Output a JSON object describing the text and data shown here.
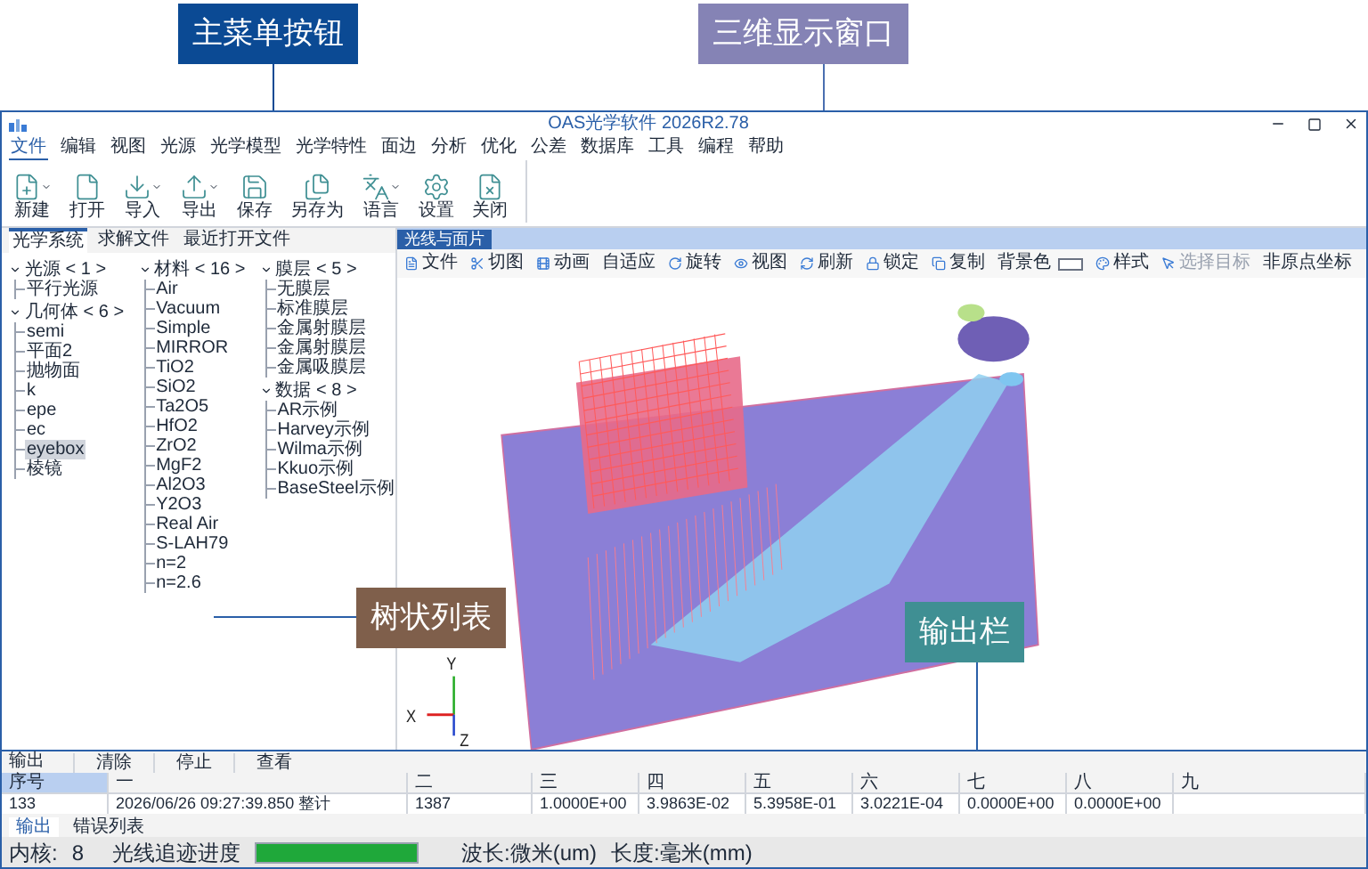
{
  "callouts": [
    {
      "text": "主菜单按钮",
      "color": "#0b4a94"
    },
    {
      "text": "三维显示窗口",
      "color": "#8583b5"
    },
    {
      "text": "树状列表",
      "color": "#7f5f4b"
    },
    {
      "text": "输出栏",
      "color": "#3f8f93"
    }
  ],
  "window": {
    "title": "OAS光学软件 2026R2.78"
  },
  "menu": [
    {
      "label": "文件",
      "selected": true
    },
    {
      "label": "编辑",
      "selected": false
    },
    {
      "label": "视图",
      "selected": false
    },
    {
      "label": "光源",
      "selected": false
    },
    {
      "label": "光学模型",
      "selected": false
    },
    {
      "label": "光学特性",
      "selected": false
    },
    {
      "label": "面边",
      "selected": false
    },
    {
      "label": "分析",
      "selected": false
    },
    {
      "label": "优化",
      "selected": false
    },
    {
      "label": "公差",
      "selected": false
    },
    {
      "label": "数据库",
      "selected": false
    },
    {
      "label": "工具",
      "selected": false
    },
    {
      "label": "编程",
      "selected": false
    },
    {
      "label": "帮助",
      "selected": false
    }
  ],
  "ribbon": [
    {
      "label": "新建",
      "dropdown": true
    },
    {
      "label": "打开",
      "dropdown": false
    },
    {
      "label": "导入",
      "dropdown": true
    },
    {
      "label": "导出",
      "dropdown": true
    },
    {
      "label": "保存",
      "dropdown": false
    },
    {
      "label": "另存为",
      "dropdown": false
    },
    {
      "label": "语言",
      "dropdown": true
    },
    {
      "label": "设置",
      "dropdown": false
    },
    {
      "label": "关闭",
      "dropdown": false
    }
  ],
  "left_tabs": [
    {
      "label": "光学系统",
      "selected": true
    },
    {
      "label": "求解文件",
      "selected": false
    },
    {
      "label": "最近打开文件",
      "selected": false
    }
  ],
  "tree": [
    {
      "label": "光源 < 1 >",
      "expanded": true,
      "selected": false,
      "children": [
        {
          "label": "平行光源",
          "selected": false
        }
      ]
    },
    {
      "label": "几何体 < 6 >",
      "expanded": true,
      "selected": false,
      "children": [
        {
          "label": "semi",
          "selected": false
        },
        {
          "label": "平面2",
          "selected": false
        },
        {
          "label": "抛物面",
          "selected": false
        },
        {
          "label": "k",
          "selected": false
        },
        {
          "label": "epe",
          "selected": false
        },
        {
          "label": "ec",
          "selected": false
        },
        {
          "label": "eyebox",
          "selected": true
        },
        {
          "label": "棱镜",
          "selected": false
        }
      ]
    },
    {
      "label": "材料 < 16 >",
      "expanded": true,
      "selected": false,
      "children": [
        {
          "label": "Air",
          "selected": false
        },
        {
          "label": "Vacuum",
          "selected": false
        },
        {
          "label": "Simple",
          "selected": false
        },
        {
          "label": "MIRROR",
          "selected": false
        },
        {
          "label": "TiO2",
          "selected": false
        },
        {
          "label": "SiO2",
          "selected": false
        },
        {
          "label": "Ta2O5",
          "selected": false
        },
        {
          "label": "HfO2",
          "selected": false
        },
        {
          "label": "ZrO2",
          "selected": false
        },
        {
          "label": "MgF2",
          "selected": false
        },
        {
          "label": "Al2O3",
          "selected": false
        },
        {
          "label": "Y2O3",
          "selected": false
        },
        {
          "label": "Real Air",
          "selected": false
        },
        {
          "label": "S-LAH79",
          "selected": false
        },
        {
          "label": "n=2",
          "selected": false
        },
        {
          "label": "n=2.6",
          "selected": false
        }
      ]
    },
    {
      "label": "膜层 < 5 >",
      "expanded": true,
      "selected": false,
      "children": [
        {
          "label": "无膜层",
          "selected": false
        },
        {
          "label": "标准膜层",
          "selected": false
        },
        {
          "label": "金属射膜层",
          "selected": false
        },
        {
          "label": "金属射膜层",
          "selected": false
        },
        {
          "label": "金属吸膜层",
          "selected": false
        }
      ]
    },
    {
      "label": "数据 < 8 >",
      "expanded": true,
      "selected": false,
      "children": [
        {
          "label": "AR示例",
          "selected": false
        },
        {
          "label": "Harvey示例",
          "selected": false
        },
        {
          "label": "Wilma示例",
          "selected": false
        },
        {
          "label": "Kkuo示例",
          "selected": false
        },
        {
          "label": "BaseSteel示例",
          "selected": false
        }
      ]
    }
  ],
  "view_tab": {
    "label": "光线与面片"
  },
  "view_toolbar": [
    {
      "label": "文件",
      "kind": "button",
      "disabled": false
    },
    {
      "label": "切图",
      "kind": "button",
      "disabled": false
    },
    {
      "label": "动画",
      "kind": "button",
      "disabled": false
    },
    {
      "label": "自适应",
      "kind": "text",
      "disabled": false
    },
    {
      "label": "旋转",
      "kind": "button",
      "disabled": false
    },
    {
      "label": "视图",
      "kind": "button",
      "disabled": false
    },
    {
      "label": "刷新",
      "kind": "button",
      "disabled": false
    },
    {
      "label": "锁定",
      "kind": "button",
      "disabled": false
    },
    {
      "label": "复制",
      "kind": "button",
      "disabled": false
    },
    {
      "label": "背景色",
      "kind": "color",
      "disabled": false
    },
    {
      "label": "样式",
      "kind": "button",
      "disabled": false
    },
    {
      "label": "选择目标",
      "kind": "button",
      "disabled": true
    },
    {
      "label": "非原点坐标",
      "kind": "text",
      "disabled": false
    }
  ],
  "axes": {
    "x": "X",
    "y": "Y",
    "z": "Z"
  },
  "output": {
    "title": "输出",
    "buttons": [
      "清除",
      "停止",
      "查看"
    ],
    "columns": [
      "序号",
      "一",
      "二",
      "三",
      "四",
      "五",
      "六",
      "七",
      "八",
      "九"
    ],
    "rows": [
      [
        "133",
        "2026/06/26 09:27:39.850 整计",
        "1387",
        "1.0000E+00",
        "3.9863E-02",
        "5.3958E-01",
        "3.0221E-04",
        "0.0000E+00",
        "0.0000E+00"
      ]
    ],
    "tabs": [
      {
        "label": "输出",
        "selected": true
      },
      {
        "label": "错误列表",
        "selected": false
      }
    ]
  },
  "status_bar": {
    "kernel_label": "内核:",
    "kernel_value": "8",
    "progress_label": "光线追迹进度",
    "progress": {
      "level": 1
    },
    "wavelength": "波长:微米(um)",
    "length": "长度:毫米(mm)"
  }
}
